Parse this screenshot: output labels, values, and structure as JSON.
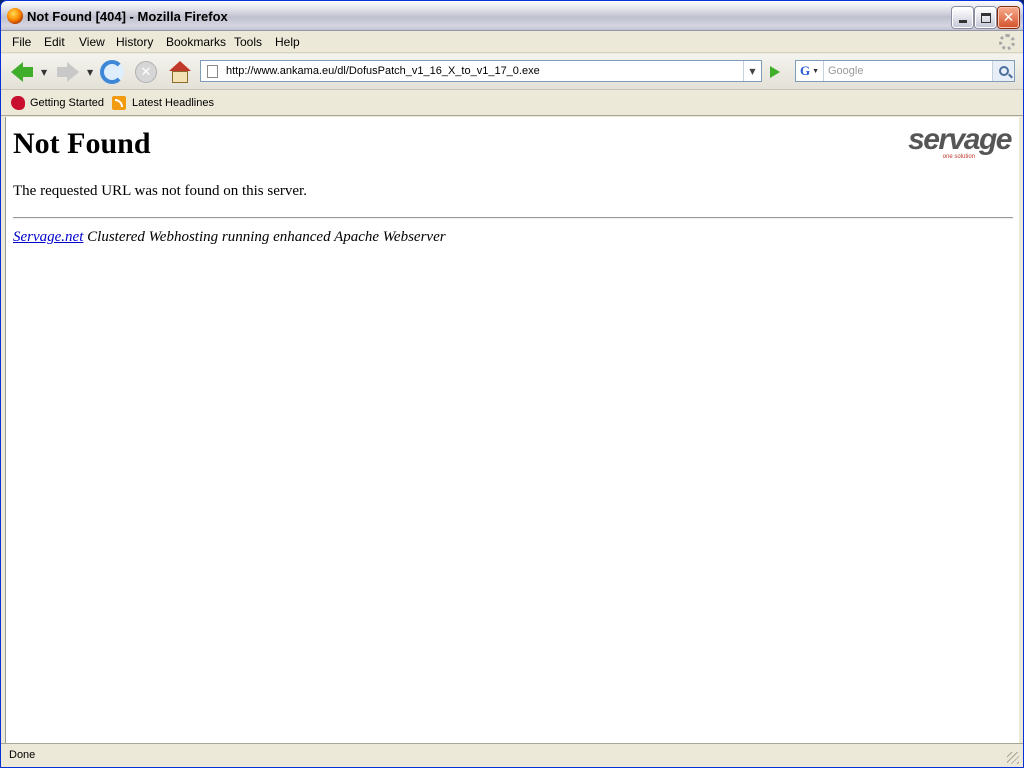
{
  "window": {
    "title": "Not Found [404] - Mozilla Firefox"
  },
  "menu": {
    "items": [
      "File",
      "Edit",
      "View",
      "History",
      "Bookmarks",
      "Tools",
      "Help"
    ]
  },
  "navigation": {
    "url": "http://www.ankama.eu/dl/DofusPatch_v1_16_X_to_v1_17_0.exe",
    "search_placeholder": "Google",
    "search_engine_icon": "G"
  },
  "bookmarks": {
    "items": [
      "Getting Started",
      "Latest Headlines"
    ]
  },
  "page": {
    "heading": "Not Found",
    "message": "The requested URL was not found on this server.",
    "footer_link": "Servage.net",
    "footer_text": " Clustered Webhosting running enhanced Apache Webserver",
    "logo_text": "servage",
    "logo_subtext": "one solution"
  },
  "status": {
    "text": "Done"
  },
  "colors": {
    "link": "#0000cc",
    "logo_accent": "#c0392b"
  }
}
